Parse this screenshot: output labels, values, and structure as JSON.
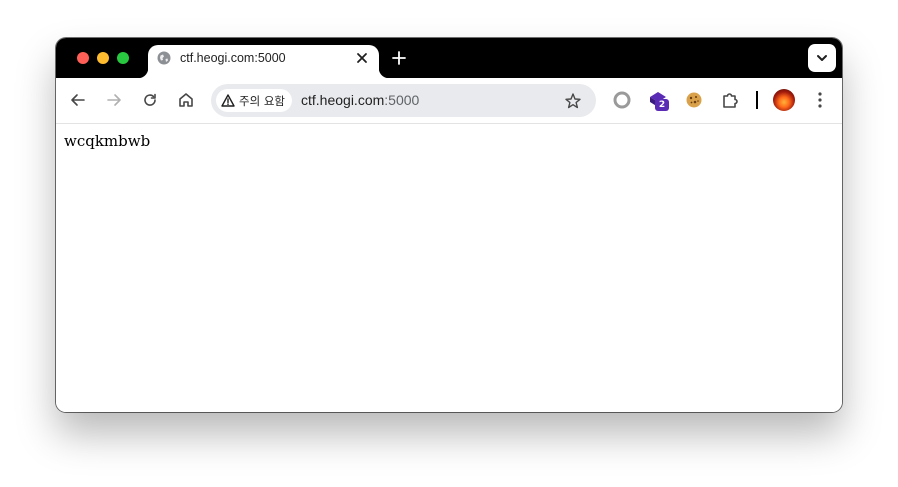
{
  "tab": {
    "title": "ctf.heogi.com:5000",
    "favicon_icon": "globe-icon"
  },
  "omnibox": {
    "security_label": "주의 요함",
    "url_host": "ctf.heogi.com",
    "url_port": ":5000"
  },
  "extensions": {
    "badge_count": "2"
  },
  "page": {
    "body_text": "wcqkmbwb"
  },
  "colors": {
    "titlebar": "#000000",
    "omnibox_bg": "#e9eaed",
    "badge": "#5a2bb4",
    "close": "#ff5f57",
    "minimize": "#febc2e",
    "maximize": "#28c840"
  }
}
